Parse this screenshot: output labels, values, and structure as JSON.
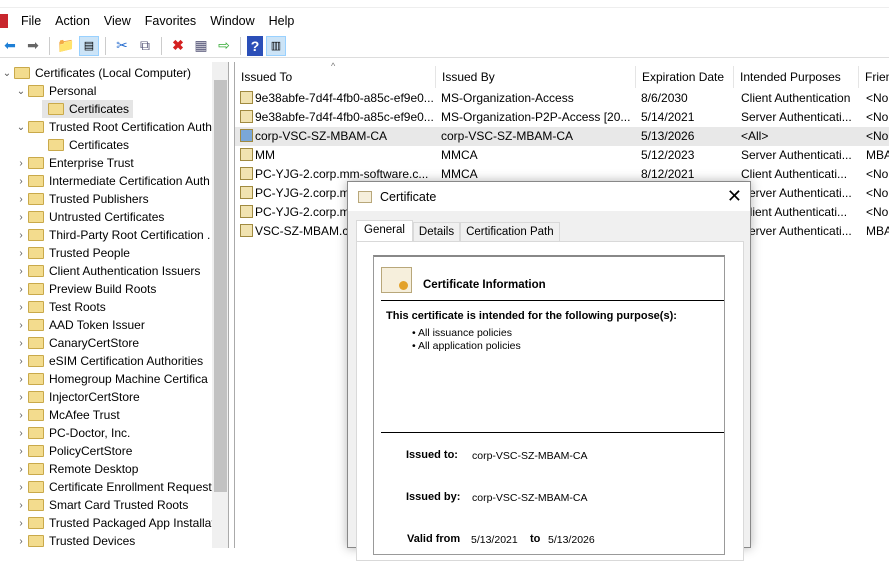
{
  "menu": [
    "File",
    "Action",
    "View",
    "Favorites",
    "Window",
    "Help"
  ],
  "toolbar": [
    "back-icon",
    "forward-icon",
    "up-folder-icon",
    "show-hide-tree-icon",
    "cut-icon",
    "copy-icon",
    "delete-icon",
    "properties-icon",
    "export-icon",
    "help-icon",
    "action-pane-icon"
  ],
  "tree": [
    {
      "label": "Certificates (Local Computer)",
      "level": 0,
      "chev": "v"
    },
    {
      "label": "Personal",
      "level": 1,
      "chev": "v"
    },
    {
      "label": "Certificates",
      "level": 2,
      "chev": "",
      "selected": true
    },
    {
      "label": "Trusted Root Certification Auth",
      "level": 1,
      "chev": "v"
    },
    {
      "label": "Certificates",
      "level": 2,
      "chev": ""
    },
    {
      "label": "Enterprise Trust",
      "level": 1,
      "chev": ">"
    },
    {
      "label": "Intermediate Certification Auth",
      "level": 1,
      "chev": ">"
    },
    {
      "label": "Trusted Publishers",
      "level": 1,
      "chev": ">"
    },
    {
      "label": "Untrusted Certificates",
      "level": 1,
      "chev": ">"
    },
    {
      "label": "Third-Party Root Certification .",
      "level": 1,
      "chev": ">"
    },
    {
      "label": "Trusted People",
      "level": 1,
      "chev": ">"
    },
    {
      "label": "Client Authentication Issuers",
      "level": 1,
      "chev": ">"
    },
    {
      "label": "Preview Build Roots",
      "level": 1,
      "chev": ">"
    },
    {
      "label": "Test Roots",
      "level": 1,
      "chev": ">"
    },
    {
      "label": "AAD Token Issuer",
      "level": 1,
      "chev": ">"
    },
    {
      "label": "CanaryCertStore",
      "level": 1,
      "chev": ">"
    },
    {
      "label": "eSIM Certification Authorities",
      "level": 1,
      "chev": ">"
    },
    {
      "label": "Homegroup Machine Certifica",
      "level": 1,
      "chev": ">"
    },
    {
      "label": "InjectorCertStore",
      "level": 1,
      "chev": ">"
    },
    {
      "label": "McAfee Trust",
      "level": 1,
      "chev": ">"
    },
    {
      "label": "PC-Doctor, Inc.",
      "level": 1,
      "chev": ">"
    },
    {
      "label": "PolicyCertStore",
      "level": 1,
      "chev": ">"
    },
    {
      "label": "Remote Desktop",
      "level": 1,
      "chev": ">"
    },
    {
      "label": "Certificate Enrollment Request",
      "level": 1,
      "chev": ">"
    },
    {
      "label": "Smart Card Trusted Roots",
      "level": 1,
      "chev": ">"
    },
    {
      "label": "Trusted Packaged App Installat",
      "level": 1,
      "chev": ">"
    },
    {
      "label": "Trusted Devices",
      "level": 1,
      "chev": ">"
    }
  ],
  "columns": [
    "Issued To",
    "Issued By",
    "Expiration Date",
    "Intended Purposes",
    "Friendly Name"
  ],
  "rows": [
    [
      "9e38abfe-7d4f-4fb0-a85c-ef9e0...",
      "MS-Organization-Access",
      "8/6/2030",
      "Client Authentication",
      "<None>"
    ],
    [
      "9e38abfe-7d4f-4fb0-a85c-ef9e0...",
      "MS-Organization-P2P-Access [20...",
      "5/14/2021",
      "Server Authenticati...",
      "<None>"
    ],
    [
      "corp-VSC-SZ-MBAM-CA",
      "corp-VSC-SZ-MBAM-CA",
      "5/13/2026",
      "<All>",
      "<None>"
    ],
    [
      "MM",
      "MMCA",
      "5/12/2023",
      "Server Authenticati...",
      "MBAM"
    ],
    [
      "PC-YJG-2.corp.mm-software.c...",
      "MMCA",
      "8/12/2021",
      "Client Authenticati...",
      "<None>"
    ],
    [
      "PC-YJG-2.corp.m",
      "",
      "",
      "Server Authenticati...",
      "<None>"
    ],
    [
      "PC-YJG-2.corp.m",
      "",
      "",
      "Client Authenticati...",
      "<None>"
    ],
    [
      "VSC-SZ-MBAM.c",
      "",
      "",
      "Server Authenticati...",
      "MBAM"
    ]
  ],
  "dialog": {
    "title": "Certificate",
    "tabs": [
      "General",
      "Details",
      "Certification Path"
    ],
    "info_title": "Certificate Information",
    "purpose_heading": "This certificate is intended for the following purpose(s):",
    "purposes": [
      "All issuance policies",
      "All application policies"
    ],
    "issued_to_label": "Issued to:",
    "issued_to": "corp-VSC-SZ-MBAM-CA",
    "issued_by_label": "Issued by:",
    "issued_by": "corp-VSC-SZ-MBAM-CA",
    "valid_from_label": "Valid from",
    "valid_from": "5/13/2021",
    "to_label": "to",
    "valid_to": "5/13/2026"
  }
}
